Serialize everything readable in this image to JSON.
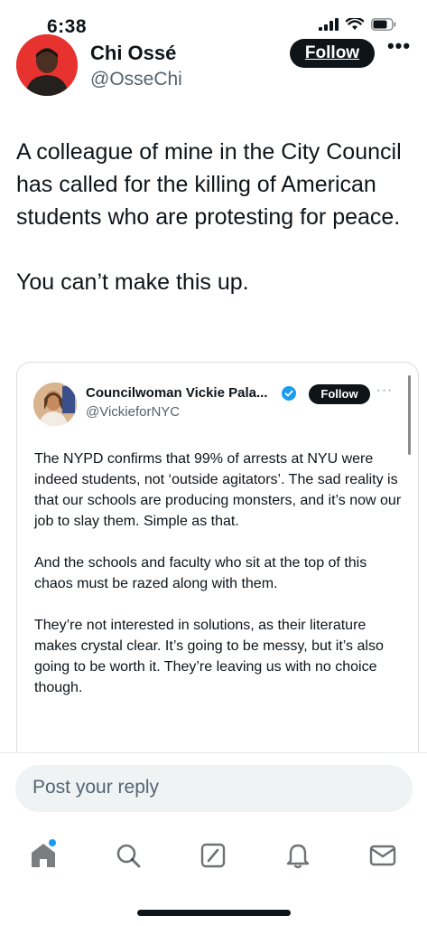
{
  "status_bar": {
    "time": "6:38"
  },
  "author": {
    "name": "Chi Ossé",
    "handle": "@OsseChi",
    "follow_label": "Follow",
    "more_label": "•••"
  },
  "post": {
    "paragraphs": [
      "A colleague of mine in the City Council has called for the killing of American students who are protesting for peace.",
      "You can’t make this up."
    ]
  },
  "quote": {
    "name": "Councilwoman Vickie Pala...",
    "handle": "@VickieforNYC",
    "follow_label": "Follow",
    "more_label": "···",
    "paragraphs": [
      "The NYPD confirms that 99% of arrests at NYU were indeed students, not ‘outside agitators’. The sad reality is that our schools are producing monsters, and it’s now our job to slay them. Simple as that.",
      "And the schools and faculty who sit at the top of this chaos must be razed along with them.",
      "They’re not interested in solutions, as their literature makes crystal clear. It’s going to be messy, but it’s also going to be worth it. They’re leaving us with no choice though."
    ]
  },
  "reply": {
    "placeholder": "Post your reply"
  },
  "tabs": [
    {
      "icon": "home-icon"
    },
    {
      "icon": "search-icon"
    },
    {
      "icon": "grok-icon"
    },
    {
      "icon": "notifications-icon"
    },
    {
      "icon": "messages-icon"
    }
  ],
  "colors": {
    "accent": "#1d9bf0",
    "text": "#0f1419",
    "secondary": "#536471",
    "avatar_bg": "#e8322f"
  }
}
